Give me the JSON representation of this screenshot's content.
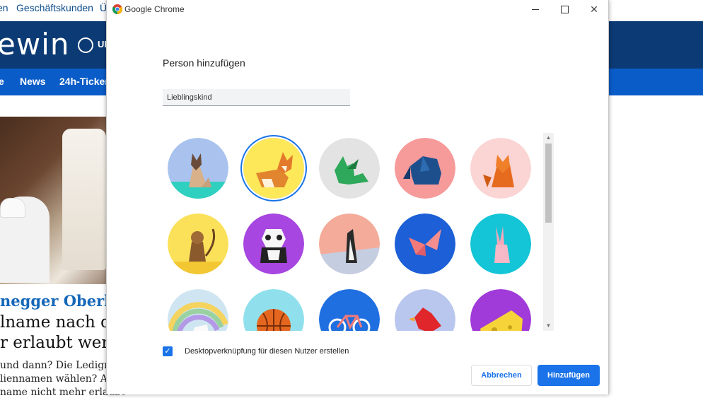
{
  "background_site": {
    "top_links": [
      "en",
      "Geschäftskunden",
      "Ü"
    ],
    "logo_text": "ewin",
    "header_partial": "UI",
    "nav": [
      "e",
      "News",
      "24h-Ticker"
    ],
    "kicker": "negger Oberh",
    "headline_lines": [
      "lname nach de",
      "r erlaubt werde"
    ],
    "body_lines": [
      "und dann? Die Ledignam",
      "liennamen wählen? Abe",
      "name nicht mehr erlaubt"
    ]
  },
  "window": {
    "title": "Google Chrome",
    "minimize_label": "",
    "maximize_label": "",
    "close_label": "✕"
  },
  "dialog": {
    "heading": "Person hinzufügen",
    "name_value": "Lieblingskind",
    "avatars": [
      {
        "name": "cat",
        "bg": "#a9c3ee",
        "selected": false
      },
      {
        "name": "corgi",
        "bg": "#fde85a",
        "selected": true
      },
      {
        "name": "dragon",
        "bg": "#e3e3e3",
        "selected": false
      },
      {
        "name": "elephant",
        "bg": "#f69a9a",
        "selected": false
      },
      {
        "name": "fox",
        "bg": "#fbd4d4",
        "selected": false
      },
      {
        "name": "monkey",
        "bg": "#fbe15a",
        "selected": false
      },
      {
        "name": "panda",
        "bg": "#a746e0",
        "selected": false
      },
      {
        "name": "penguin",
        "bg": "#f4ab9a",
        "selected": false
      },
      {
        "name": "butterfly",
        "bg": "#1c5fd6",
        "selected": false
      },
      {
        "name": "rabbit",
        "bg": "#13c5d6",
        "selected": false
      },
      {
        "name": "unicorn",
        "bg": "#cfe6f2",
        "selected": false
      },
      {
        "name": "basketball",
        "bg": "#8fe0ec",
        "selected": false
      },
      {
        "name": "bicycle",
        "bg": "#1f6fe0",
        "selected": false
      },
      {
        "name": "bird",
        "bg": "#b9c7ee",
        "selected": false
      },
      {
        "name": "cheese",
        "bg": "#a03ad8",
        "selected": false
      }
    ],
    "checkbox_checked": true,
    "checkbox_label": "Desktopverknüpfung für diesen Nutzer erstellen",
    "cancel_label": "Abbrechen",
    "add_label": "Hinzufügen"
  },
  "colors": {
    "accent": "#1a73e8",
    "site_header": "#0c3a74",
    "site_nav": "#0a5cc8"
  }
}
